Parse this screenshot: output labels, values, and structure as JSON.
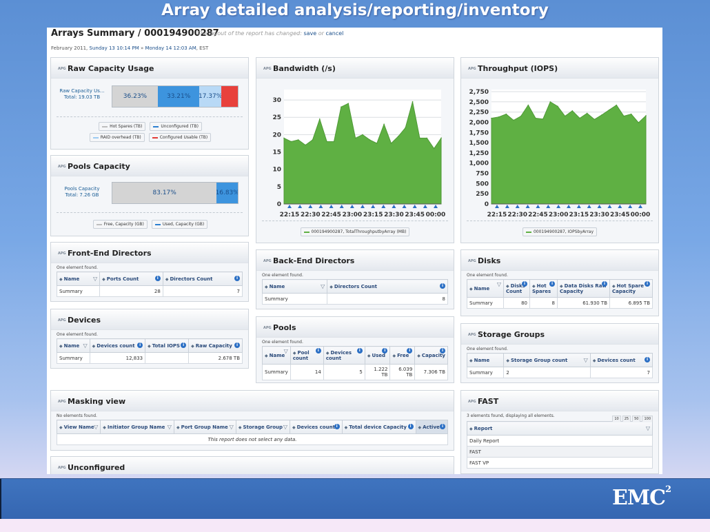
{
  "slide": {
    "title": "Array detailed analysis/reporting/inventory",
    "logo": "EMC",
    "logo_sup": "2"
  },
  "report": {
    "title": "Arrays Summary / 000194900287",
    "note_prefix": "The layout of the report has changed:",
    "save": "save",
    "or": "or",
    "cancel": "cancel",
    "date_month": "February 2011,",
    "date_start": "Sunday 13 10:14 PM",
    "date_sep": "»",
    "date_end": "Monday 14 12:03 AM",
    "date_tz": ", EST"
  },
  "panel_tag": "APG",
  "raw_capacity": {
    "title": "Raw Capacity Usage",
    "label_line1": "Raw Capacity Us...",
    "label_line2": "Total: 19.03 TB",
    "segments": [
      {
        "label": "36.23%",
        "pct": 36.23,
        "color": "#d4d4d4"
      },
      {
        "label": "33.21%",
        "pct": 33.21,
        "color": "#3d94de"
      },
      {
        "label": "17.37%",
        "pct": 17.37,
        "color": "#b8d9f6"
      },
      {
        "label": "",
        "pct": 13.19,
        "color": "#e8413c"
      }
    ],
    "legend": [
      {
        "label": "Hot Spares (TB)",
        "color": "#bdbdbd"
      },
      {
        "label": "Unconfigured (TB)",
        "color": "#2b7fd0"
      },
      {
        "label": "RAID overhead (TB)",
        "color": "#9ccaf2"
      },
      {
        "label": "Configured Usable (TB)",
        "color": "#e23a36"
      }
    ]
  },
  "pools_capacity": {
    "title": "Pools Capacity",
    "label_line1": "Pools Capacity",
    "label_line2": "Total: 7.26 GB",
    "segments": [
      {
        "label": "83.17%",
        "pct": 83.17,
        "color": "#d4d4d4"
      },
      {
        "label": "16.83%",
        "pct": 16.83,
        "color": "#3d94de"
      }
    ],
    "legend": [
      {
        "label": "Free, Capacity (GB)",
        "color": "#bdbdbd"
      },
      {
        "label": "Used, Capacity (GB)",
        "color": "#2b7fd0"
      }
    ]
  },
  "bandwidth": {
    "title": "Bandwidth (/s)",
    "legend": "000194900287, TotalThroughputbyArray (MB)"
  },
  "throughput": {
    "title": "Throughput (IOPS)",
    "legend": "000194900287, IOPSbyArray"
  },
  "chart_data": [
    {
      "type": "area",
      "title": "Bandwidth (/s)",
      "x": [
        "22:15",
        "22:30",
        "22:45",
        "23:00",
        "23:15",
        "23:30",
        "23:45",
        "00:00"
      ],
      "ylim": [
        0,
        33
      ],
      "yticks": [
        0,
        5,
        10,
        15,
        20,
        25,
        30
      ],
      "color": "#5fb043",
      "values": [
        19,
        18,
        18.5,
        17,
        18.5,
        24.5,
        18,
        18,
        28,
        29,
        19,
        20,
        18.5,
        17.5,
        23,
        17.5,
        19.5,
        22,
        29.5,
        19,
        19,
        16,
        19
      ]
    },
    {
      "type": "area",
      "title": "Throughput (IOPS)",
      "x": [
        "22:15",
        "22:30",
        "22:45",
        "23:00",
        "23:15",
        "23:30",
        "23:45",
        "00:00"
      ],
      "ylim": [
        0,
        2800
      ],
      "yticks": [
        0,
        250,
        500,
        750,
        1000,
        1250,
        1500,
        1750,
        2000,
        2250,
        2500,
        2750
      ],
      "yticklabels": [
        "0",
        "250",
        "500",
        "750",
        "1,000",
        "1,250",
        "1,500",
        "1,750",
        "2,000",
        "2,250",
        "2,500",
        "2,750"
      ],
      "color": "#5fb043",
      "values": [
        2100,
        2130,
        2200,
        2050,
        2150,
        2420,
        2100,
        2080,
        2500,
        2390,
        2150,
        2280,
        2100,
        2220,
        2070,
        2180,
        2300,
        2420,
        2150,
        2200,
        1990,
        2160
      ]
    }
  ],
  "fe_directors": {
    "title": "Front-End Directors",
    "found": "One element found.",
    "headers": [
      "Name",
      "Ports Count",
      "Directors Count"
    ],
    "rows": [
      [
        "Summary",
        "28",
        "7"
      ]
    ]
  },
  "devices": {
    "title": "Devices",
    "found": "One element found.",
    "headers": [
      "Name",
      "Devices count",
      "Total IOPS",
      "Raw Capacity"
    ],
    "rows": [
      [
        "Summary",
        "12,833",
        "",
        "2.678 TB"
      ]
    ]
  },
  "be_directors": {
    "title": "Back-End Directors",
    "found": "One element found.",
    "headers": [
      "Name",
      "Directors Count"
    ],
    "rows": [
      [
        "Summary",
        "8"
      ]
    ]
  },
  "pools": {
    "title": "Pools",
    "found": "One element found.",
    "headers": [
      "Name",
      "Pool count",
      "Devices count",
      "Used",
      "Free",
      "Capacity"
    ],
    "rows": [
      [
        "Summary",
        "14",
        "5",
        "1.222 TB",
        "6.039 TB",
        "7.306 TB"
      ]
    ]
  },
  "disks": {
    "title": "Disks",
    "found": "One element found.",
    "headers": [
      "Name",
      "Disks Count",
      "Hot Spares",
      "Data Disks Raw Capacity",
      "Hot Spare Capacity"
    ],
    "rows": [
      [
        "Summary",
        "80",
        "8",
        "61.930 TB",
        "6.895 TB"
      ]
    ]
  },
  "storage_groups": {
    "title": "Storage Groups",
    "found": "One element found.",
    "headers": [
      "Name",
      "Storage Group count",
      "Devices count"
    ],
    "rows": [
      [
        "Summary",
        "2",
        "7"
      ]
    ]
  },
  "masking": {
    "title": "Masking view",
    "found": "No elements found.",
    "headers": [
      "View Name",
      "Initiator Group Name",
      "Port Group Name",
      "Storage Group",
      "Devices count",
      "Total device Capacity",
      "Active?"
    ],
    "empty": "This report does not select any data."
  },
  "fast": {
    "title": "FAST",
    "found": "3 elements found, displaying all elements.",
    "pages": [
      "10",
      "25",
      "50",
      "100"
    ],
    "header": "Report",
    "rows": [
      "Daily Report",
      "FAST",
      "FAST VP"
    ]
  },
  "unconfigured": {
    "title": "Unconfigured"
  }
}
